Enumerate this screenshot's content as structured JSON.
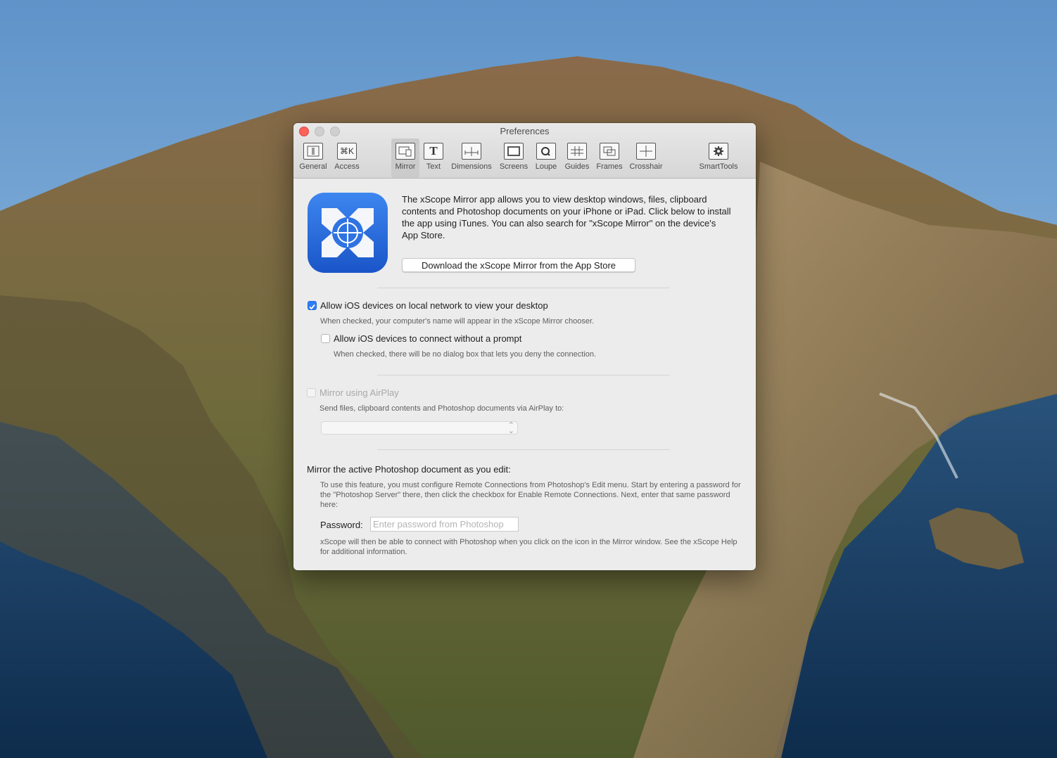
{
  "window": {
    "title": "Preferences"
  },
  "toolbar": {
    "items": [
      {
        "label": "General",
        "icon": "general-icon"
      },
      {
        "label": "Access",
        "icon": "command-key-icon",
        "glyph": "⌘K"
      },
      {
        "label": "Mirror",
        "icon": "mirror-icon",
        "selected": true
      },
      {
        "label": "Text",
        "icon": "text-icon",
        "glyph": "T"
      },
      {
        "label": "Dimensions",
        "icon": "dimensions-icon"
      },
      {
        "label": "Screens",
        "icon": "screens-icon"
      },
      {
        "label": "Loupe",
        "icon": "loupe-icon"
      },
      {
        "label": "Guides",
        "icon": "guides-icon"
      },
      {
        "label": "Frames",
        "icon": "frames-icon"
      },
      {
        "label": "Crosshair",
        "icon": "crosshair-icon"
      },
      {
        "label": "SmartTools",
        "icon": "gear-icon"
      }
    ]
  },
  "mirror": {
    "intro": "The xScope Mirror app allows you to view desktop windows, files, clipboard contents and Photoshop documents on your iPhone or iPad. Click below to install the app using iTunes. You can also search for \"xScope Mirror\" on the device's App Store.",
    "download_label": "Download the xScope Mirror from the App Store",
    "allow_ios": {
      "label": "Allow iOS devices on local network to view your desktop",
      "note": "When checked, your computer's name will appear in the xScope Mirror chooser.",
      "checked": true
    },
    "allow_no_prompt": {
      "label": "Allow iOS devices to connect without a prompt",
      "note": "When checked, there will be no dialog box that lets you deny the connection.",
      "checked": false
    },
    "airplay": {
      "label": "Mirror using AirPlay",
      "note": "Send files, clipboard contents and Photoshop documents via AirPlay to:",
      "enabled": false
    },
    "photoshop": {
      "heading": "Mirror the active Photoshop document as you edit:",
      "instructions": "To use this feature, you must configure Remote Connections from Photoshop's Edit menu. Start by entering a password for the \"Photoshop Server\" there, then click the checkbox for Enable Remote Connections. Next, enter that same password here:",
      "password_label": "Password:",
      "password_placeholder": "Enter password from Photoshop",
      "footer": "xScope will then be able to connect with Photoshop when you click on the icon in the Mirror window. See the xScope Help for additional information."
    }
  },
  "colors": {
    "accent": "#2e7cf6",
    "app_icon_blue": "#1f63d6"
  }
}
